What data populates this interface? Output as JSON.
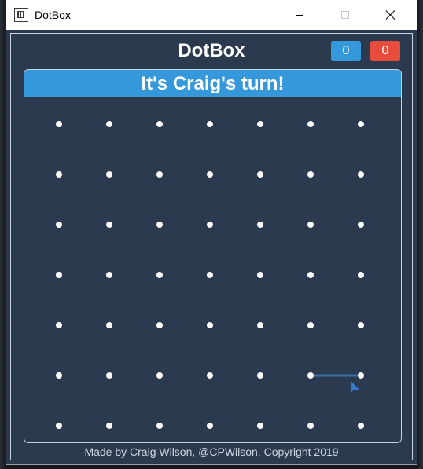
{
  "window": {
    "title": "DotBox"
  },
  "header": {
    "title": "DotBox",
    "scores": [
      {
        "player": "blue",
        "value": "0",
        "color": "#3498db"
      },
      {
        "player": "red",
        "value": "0",
        "color": "#e74c3c"
      }
    ]
  },
  "board": {
    "turn_text": "It's Craig's turn!",
    "rows": 7,
    "cols": 7,
    "dot_color": "#ffffff",
    "highlight_line": {
      "from": {
        "row": 5,
        "col": 5
      },
      "to": {
        "row": 5,
        "col": 6
      },
      "color": "#3d6ea5"
    }
  },
  "footer": {
    "text": "Made by Craig Wilson, @CPWilson. Copyright 2019"
  },
  "colors": {
    "background": "#2b3a4f",
    "banner": "#3498db"
  }
}
